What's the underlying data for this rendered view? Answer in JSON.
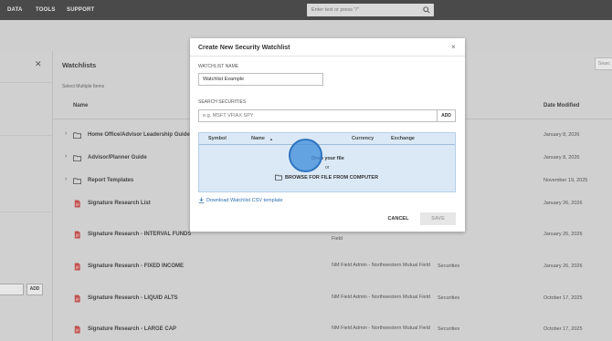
{
  "topnav": {
    "items": [
      "DATA",
      "TOOLS",
      "SUPPORT"
    ],
    "search_placeholder": "Enter text or press \"/\""
  },
  "left_panel": {
    "add_button": "ADD"
  },
  "main": {
    "title": "Watchlists",
    "subtitle": "Select Multiple Items",
    "right_search": "Searc",
    "columns": {
      "name": "Name",
      "date_modified": "Date Modified"
    },
    "rows": [
      {
        "type": "folder",
        "name": "Home Office/Advisor Leadership Guide",
        "owner": "",
        "security_type": "",
        "date": "January 8, 2026"
      },
      {
        "type": "folder",
        "name": "Advisor/Planner Guide",
        "owner": "",
        "security_type": "",
        "date": "January 8, 2026"
      },
      {
        "type": "folder",
        "name": "Report Templates",
        "owner": "",
        "security_type": "",
        "date": "November 19, 2025"
      },
      {
        "type": "file",
        "name": "Signature Research List",
        "owner": "",
        "security_type": "",
        "date": "January 26, 2026"
      },
      {
        "type": "file",
        "name": "Signature Research - INTERVAL FUNDS",
        "owner": "Field",
        "security_type": "",
        "date": "January 26, 2026"
      },
      {
        "type": "file",
        "name": "Signature Research - FIXED INCOME",
        "owner": "NM Field Admin - Northwestern Mutual Field",
        "security_type": "Securities",
        "date": "January 26, 2026"
      },
      {
        "type": "file",
        "name": "Signature Research - LIQUID ALTS",
        "owner": "NM Field Admin - Northwestern Mutual Field",
        "security_type": "Securities",
        "date": "October 17, 2025"
      },
      {
        "type": "file",
        "name": "Signature Research - LARGE CAP",
        "owner": "NM Field Admin - Northwestern Mutual Field",
        "security_type": "Securities",
        "date": "October 17, 2025"
      }
    ]
  },
  "modal": {
    "title": "Create New Security Watchlist",
    "close": "×",
    "watchlist_name_label": "WATCHLIST NAME",
    "watchlist_name_value": "Watchlist Example",
    "search_label": "SEARCH SECURITIES",
    "search_placeholder": "e.g. MSFT VFIAX SPY",
    "add_button": "ADD",
    "table_headers": {
      "symbol": "Symbol",
      "name": "Name",
      "sort_indicator": "▲",
      "currency": "Currency",
      "exchange": "Exchange"
    },
    "drop_text": "Drop your file",
    "or_text": "or",
    "browse_text": "BROWSE FOR FILE FROM COMPUTER",
    "csv_link": "Download Watchlist CSV template",
    "cancel_button": "CANCEL",
    "save_button": "SAVE"
  },
  "colors": {
    "nav_bg": "#4a4a4a",
    "overlay": "#d0d0d0",
    "dropzone": "#dbe9f7",
    "link": "#2e6fb1",
    "cursor": "#4691dc"
  }
}
